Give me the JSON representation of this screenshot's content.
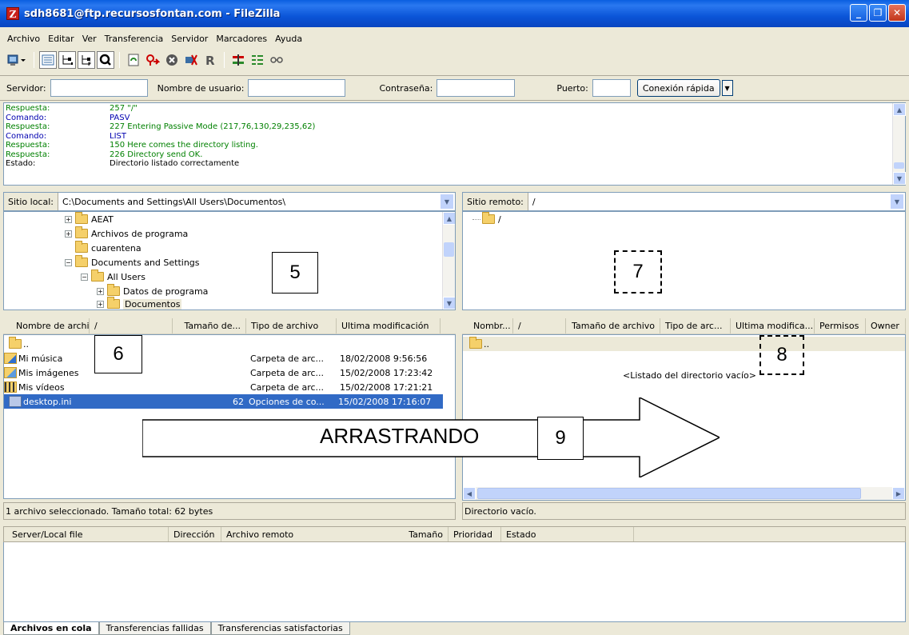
{
  "window": {
    "title": "sdh8681@ftp.recursosfontan.com - FileZilla",
    "app_icon_glyph": "Z",
    "minimize_glyph": "_",
    "maximize_glyph": "❐",
    "close_glyph": "✕"
  },
  "menu": [
    "Archivo",
    "Editar",
    "Ver",
    "Transferencia",
    "Servidor",
    "Marcadores",
    "Ayuda"
  ],
  "toolbar": {
    "icons": [
      "site-manager-icon",
      "toggle-log-icon",
      "toggle-local-tree-icon",
      "toggle-remote-tree-icon",
      "toggle-queue-icon",
      "refresh-icon",
      "process-queue-icon",
      "cancel-icon",
      "disconnect-icon",
      "reconnect-icon",
      "filter-icon",
      "compare-icon",
      "sync-browse-icon"
    ]
  },
  "quickconnect": {
    "host_label": "Servidor:",
    "host_value": "",
    "user_label": "Nombre de usuario:",
    "user_value": "",
    "pass_label": "Contraseña:",
    "pass_value": "",
    "port_label": "Puerto:",
    "port_value": "",
    "connect_label": "Conexión rápida",
    "dropdown_glyph": "▼"
  },
  "log": [
    {
      "type": "Respuesta:",
      "msg": "257 \"/\""
    },
    {
      "type": "Comando:",
      "msg": "PASV"
    },
    {
      "type": "Respuesta:",
      "msg": "227 Entering Passive Mode (217,76,130,29,235,62)"
    },
    {
      "type": "Comando:",
      "msg": "LIST"
    },
    {
      "type": "Respuesta:",
      "msg": "150 Here comes the directory listing."
    },
    {
      "type": "Respuesta:",
      "msg": "226 Directory send OK."
    },
    {
      "type": "Estado:",
      "msg": "Directorio listado correctamente"
    }
  ],
  "local": {
    "site_label": "Sitio local:",
    "path": "C:\\Documents and Settings\\All Users\\Documentos\\",
    "tree": [
      "AEAT",
      "Archivos de programa",
      "cuarentena",
      "Documents and Settings",
      "All Users",
      "Datos de programa",
      "Documentos"
    ],
    "columns": [
      "Nombre de archivo",
      "/",
      "Tamaño de...",
      "Tipo de archivo",
      "Ultima modificación"
    ],
    "rows": [
      {
        "name": "..",
        "size": "",
        "type": "",
        "modified": ""
      },
      {
        "name": "Mi música",
        "size": "",
        "type": "Carpeta de arc...",
        "modified": "18/02/2008 9:56:56"
      },
      {
        "name": "Mis imágenes",
        "size": "",
        "type": "Carpeta de arc...",
        "modified": "15/02/2008 17:23:42"
      },
      {
        "name": "Mis vídeos",
        "size": "",
        "type": "Carpeta de arc...",
        "modified": "15/02/2008 17:21:21"
      },
      {
        "name": "desktop.ini",
        "size": "62",
        "type": "Opciones de co...",
        "modified": "15/02/2008 17:16:07"
      }
    ],
    "status": "1 archivo seleccionado. Tamaño total: 62 bytes"
  },
  "remote": {
    "site_label": "Sitio remoto:",
    "path": "/",
    "tree": [
      "/"
    ],
    "columns": [
      "Nombr...",
      "/",
      "Tamaño de archivo",
      "Tipo de arc...",
      "Ultima modifica...",
      "Permisos",
      "Owner"
    ],
    "rows": [
      {
        "name": ".."
      }
    ],
    "empty_text": "<Listado del directorio vacío>",
    "status": "Directorio vacío."
  },
  "queue": {
    "columns": [
      "Server/Local file",
      "Dirección",
      "Archivo remoto",
      "Tamaño",
      "Prioridad",
      "Estado"
    ],
    "tabs": [
      "Archivos en cola",
      "Transferencias fallidas",
      "Transferencias satisfactorias"
    ]
  },
  "annotations": {
    "n5": "5",
    "n6": "6",
    "n7": "7",
    "n8": "8",
    "n9": "9",
    "arrow_text": "ARRASTRANDO"
  },
  "scroll_glyphs": {
    "up": "▲",
    "down": "▼",
    "left": "◀",
    "right": "▶"
  }
}
